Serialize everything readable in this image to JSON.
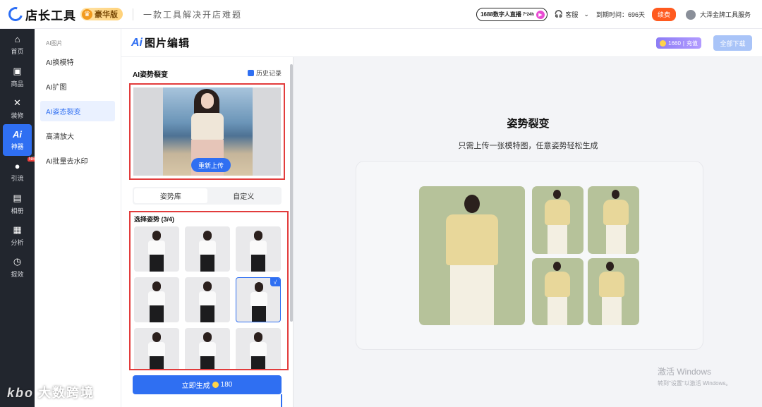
{
  "header": {
    "logo_text": "店长工具",
    "vip_label": "豪华版",
    "slogan": "一款工具解决开店难题",
    "live_label": "1688数字人直播",
    "live_sub": "7*24h",
    "service": "客服",
    "expiry_label": "到期时间：696天",
    "renew": "续费",
    "account": "大泽金牌工具服务"
  },
  "sidebar": {
    "items": [
      {
        "label": "首页",
        "icon": "home-icon"
      },
      {
        "label": "商品",
        "icon": "goods-icon"
      },
      {
        "label": "装修",
        "icon": "tools-icon"
      },
      {
        "label": "神器",
        "icon": "ai-icon",
        "glyph": "Ai"
      },
      {
        "label": "引流",
        "icon": "traffic-icon"
      },
      {
        "label": "相册",
        "icon": "album-icon"
      },
      {
        "label": "分析",
        "icon": "analysis-icon"
      },
      {
        "label": "提效",
        "icon": "clock-icon"
      }
    ],
    "new_badge": "NEW"
  },
  "submenu": {
    "group": "AI图片",
    "items": [
      "AI换模特",
      "AI扩图",
      "AI姿态裂变",
      "高清放大",
      "AI批量去水印"
    ]
  },
  "titlebar": {
    "ai": "Ai",
    "title": "图片编辑",
    "credits": "1660",
    "recharge": "充值",
    "download_all": "全部下载"
  },
  "panel": {
    "heading": "AI姿势裂变",
    "history": "历史记录",
    "reupload": "重新上传",
    "tabs": [
      "姿势库",
      "自定义"
    ],
    "select_title": "选择姿势 (3/4)",
    "check": "√",
    "generate": "立即生成",
    "generate_cost": "180"
  },
  "preview": {
    "title": "姿势裂变",
    "subtitle": "只需上传一张模特图，任意姿势轻松生成"
  },
  "watermark": {
    "line1": "激活 Windows",
    "line2": "转到\"设置\"以激活 Windows。"
  },
  "brand_watermark": {
    "mark": "kbo",
    "text": "大数跨境"
  }
}
